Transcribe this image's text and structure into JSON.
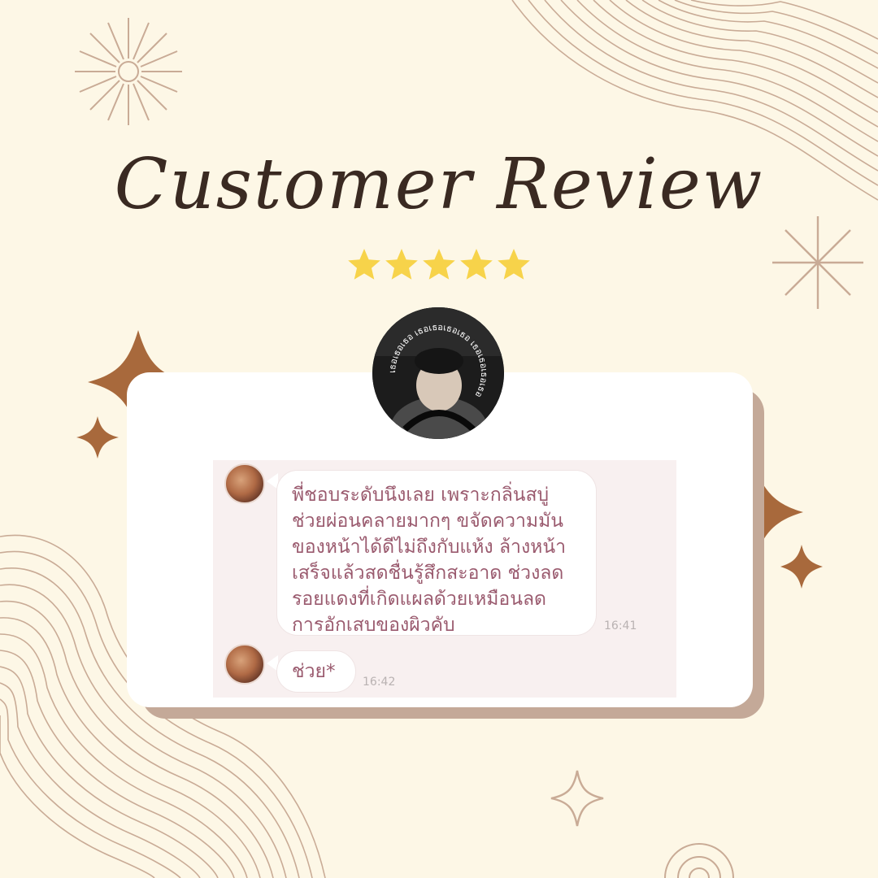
{
  "header": {
    "title": "Customer Review",
    "rating": 5
  },
  "profile": {
    "badge_text": "เธอเธอเธอ เธอเธอเธอเธอ เธอเธอเธอเธอ"
  },
  "chat": {
    "messages": [
      {
        "text": "พี่ชอบระดับนึงเลย เพราะกลิ่นสบู่\nช่วยผ่อนคลายมากๆ ขจัดความมัน\nของหน้าได้ดีไม่ถึงกับแห้ง ล้างหน้า\nเสร็จแล้วสดชื่นรู้สึกสะอาด ช่วงลด\nรอยแดงที่เกิดแผลด้วยเหมือนลด\nการอักเสบของผิวคับ",
        "time": "16:41"
      },
      {
        "text": "ช่วย*",
        "time": "16:42"
      }
    ]
  },
  "colors": {
    "background": "#fdf7e6",
    "title": "#3a2a22",
    "star": "#f7d34a",
    "sparkle": "#a8693c",
    "line_art": "#c9ab96",
    "card_shadow": "#c4a998",
    "bubble_text": "#9a5a6e"
  }
}
